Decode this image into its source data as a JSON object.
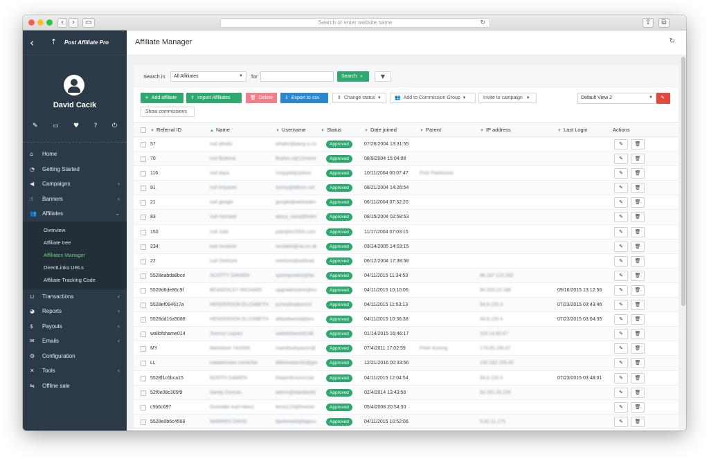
{
  "browser": {
    "url_placeholder": "Search or enter website name"
  },
  "brand": {
    "name": "Post Affiliate Pro"
  },
  "user": {
    "name": "David Cacik"
  },
  "quick_icons": [
    "pencil-icon",
    "monitor-icon",
    "heartbeat-icon",
    "help-icon",
    "power-icon"
  ],
  "nav": {
    "items": [
      {
        "label": "Home",
        "icon": "home-icon",
        "chevron": false
      },
      {
        "label": "Getting Started",
        "icon": "gauge-icon",
        "chevron": false
      },
      {
        "label": "Campaigns",
        "icon": "megaphone-icon",
        "chevron": true
      },
      {
        "label": "Banners",
        "icon": "hand-icon",
        "chevron": true
      },
      {
        "label": "Affiliates",
        "icon": "users-icon",
        "chevron": true,
        "expanded": true
      }
    ],
    "sub_items": [
      {
        "label": "Overview",
        "active": false
      },
      {
        "label": "Affiliate tree",
        "active": false
      },
      {
        "label": "Affiliates Manager",
        "active": true
      },
      {
        "label": "DirectLinks URLs",
        "active": false
      },
      {
        "label": "Affiliate Tracking Code",
        "active": false
      }
    ],
    "items_after": [
      {
        "label": "Transactions",
        "icon": "basket-icon",
        "chevron": true
      },
      {
        "label": "Reports",
        "icon": "pie-icon",
        "chevron": true
      },
      {
        "label": "Payouts",
        "icon": "moneybag-icon",
        "chevron": true
      },
      {
        "label": "Emails",
        "icon": "envelope-icon",
        "chevron": true
      },
      {
        "label": "Configuration",
        "icon": "cog-icon",
        "chevron": false
      },
      {
        "label": "Tools",
        "icon": "wrench-icon",
        "chevron": true
      },
      {
        "label": "Offline sale",
        "icon": "offline-icon",
        "chevron": false
      }
    ]
  },
  "page": {
    "title": "Affiliate Manager"
  },
  "search": {
    "search_in_label": "Search in",
    "search_in_value": "All Affiliates",
    "for_label": "for",
    "query": "",
    "search_button": "Search"
  },
  "toolbar": {
    "add_affiliate": "Add affiliate",
    "import_affiliates": "Import Affiliates",
    "delete": "Delete",
    "export_csv": "Export to csv",
    "change_status": "Change status",
    "add_to_commission_group": "Add to Commission Group",
    "invite_to_campaign": "Invite to campaign",
    "view_select": "Default View 2",
    "show_commissions": "Show commissions"
  },
  "table": {
    "columns": [
      "Referral ID",
      "Name",
      "Username",
      "Status",
      "Date joined",
      "Parent",
      "IP address",
      "Last Login",
      "Actions"
    ],
    "rows": [
      {
        "ref": "57",
        "name": "null alhafiz",
        "username": "alhafiz@pang-u.co",
        "status": "Approved",
        "date": "07/26/2004 13:31:55",
        "parent": "",
        "ip": "",
        "last": ""
      },
      {
        "ref": "70",
        "name": "null Brahma",
        "username": "Brahm.o@12move",
        "status": "Approved",
        "date": "08/9/2004 15:04:08",
        "parent": "",
        "ip": "",
        "last": ""
      },
      {
        "ref": "116",
        "name": "null daya",
        "username": "mrqupid@yahoo",
        "status": "Approved",
        "date": "10/11/2004 00:07:47",
        "parent": "Piotr Pawlowski",
        "ip": "",
        "last": ""
      },
      {
        "ref": "91",
        "name": "null finlyanto",
        "username": "sonny@tdkom.net",
        "status": "Approved",
        "date": "08/21/2004 14:26:54",
        "parent": "",
        "ip": "",
        "last": ""
      },
      {
        "ref": "21",
        "name": "null google",
        "username": "google@webradev",
        "status": "Approved",
        "date": "06/11/2004 07:32:20",
        "parent": "",
        "ip": "",
        "last": ""
      },
      {
        "ref": "83",
        "name": "null Humaidi",
        "username": "alisss_nava@hotm",
        "status": "Approved",
        "date": "08/15/2004 02:58:53",
        "parent": "",
        "ip": "",
        "last": ""
      },
      {
        "ref": "150",
        "name": "null Julie",
        "username": "julie@wr2000.com",
        "status": "Approved",
        "date": "11/17/2004 07:03:15",
        "parent": "",
        "ip": "",
        "last": ""
      },
      {
        "ref": "234",
        "name": "null nicolash",
        "username": "nicolash@na.co.uk",
        "status": "Approved",
        "date": "03/14/2005 14:03:15",
        "parent": "",
        "ip": "",
        "last": ""
      },
      {
        "ref": "22",
        "name": "null Overture",
        "username": "overture@webrad",
        "status": "Approved",
        "date": "06/12/2004 17:38:58",
        "parent": "",
        "ip": "",
        "last": ""
      },
      {
        "ref": "5528eabda8bce",
        "name": "SCOTTY DAMIEN",
        "username": "sportspredict@fac",
        "status": "Approved",
        "date": "04/11/2015 11:34:53",
        "parent": "",
        "ip": "86.187.122.202",
        "last": ""
      },
      {
        "ref": "5528d6de86c9f",
        "name": "BEARDSLEY RICHARD",
        "username": "upgradeonline@eu",
        "status": "Approved",
        "date": "04/11/2015 10:10:06",
        "parent": "",
        "ip": "90.203.23.188",
        "last": "09/16/2015 13:12:56"
      },
      {
        "ref": "5528ef094617a",
        "name": "HENDERSON ELIZABETH",
        "username": "pcheathsaborsnt",
        "status": "Approved",
        "date": "04/11/2015 11:53:13",
        "parent": "",
        "ip": "94.8.120.4",
        "last": "07/23/2015 03:43:46"
      },
      {
        "ref": "5528dd16a5088",
        "name": "HENDERSON ELIZABETH",
        "username": "affiliateworld@em",
        "status": "Approved",
        "date": "04/11/2015 10:36:38",
        "parent": "",
        "ip": "94.8.120.4",
        "last": "07/23/2015 03:04:35"
      },
      {
        "ref": "wallofshame014",
        "name": "Jhonny Loquez",
        "username": "wallofshame0148",
        "status": "Approved",
        "date": "01/14/2015 16:46:17",
        "parent": "",
        "ip": "103.14.60.67",
        "last": ""
      },
      {
        "ref": "MY",
        "name": "Mamdouh YASSIN",
        "username": "mamdouhyassin@",
        "status": "Approved",
        "date": "07/4/2011 17:02:59",
        "parent": "Peter Koning",
        "ip": "178.65.185.87",
        "last": ""
      },
      {
        "ref": "LL",
        "name": "natalieloulse mcritchie",
        "username": "littlelouisecrits@gm",
        "status": "Approved",
        "date": "12/21/2016 00:33:56",
        "parent": "",
        "ip": "130.162.155.45",
        "last": ""
      },
      {
        "ref": "5528f1c6bca15",
        "name": "NORTH DAMIEN",
        "username": "theperfectunivrsal",
        "status": "Approved",
        "date": "04/11/2015 12:04:54",
        "parent": "",
        "ip": "94.8.120.4",
        "last": "07/23/2015 03:48:01"
      },
      {
        "ref": "52f0e08c305f9",
        "name": "Sandy Duncan",
        "username": "admin@standardd",
        "status": "Approved",
        "date": "02/4/2014 13:43:56",
        "parent": "",
        "ip": "92.161.35.226",
        "last": ""
      },
      {
        "ref": "c5b6c697",
        "name": "Schindler Karl-Heinz",
        "username": "femo123@freenet",
        "status": "Approved",
        "date": "05/4/2008 20:54:30",
        "parent": "",
        "ip": "",
        "last": ""
      },
      {
        "ref": "5528e0b6c4568",
        "name": "WARREN DAVID",
        "username": "tipsterweb@tiqanu",
        "status": "Approved",
        "date": "04/11/2015 10:52:06",
        "parent": "",
        "ip": "5.62.11.173",
        "last": ""
      }
    ]
  },
  "colors": {
    "sidebar": "#2b3a46",
    "accent_green": "#2fa86f",
    "blue": "#2a87d0",
    "pink": "#f07e8b",
    "red": "#e0493c"
  }
}
